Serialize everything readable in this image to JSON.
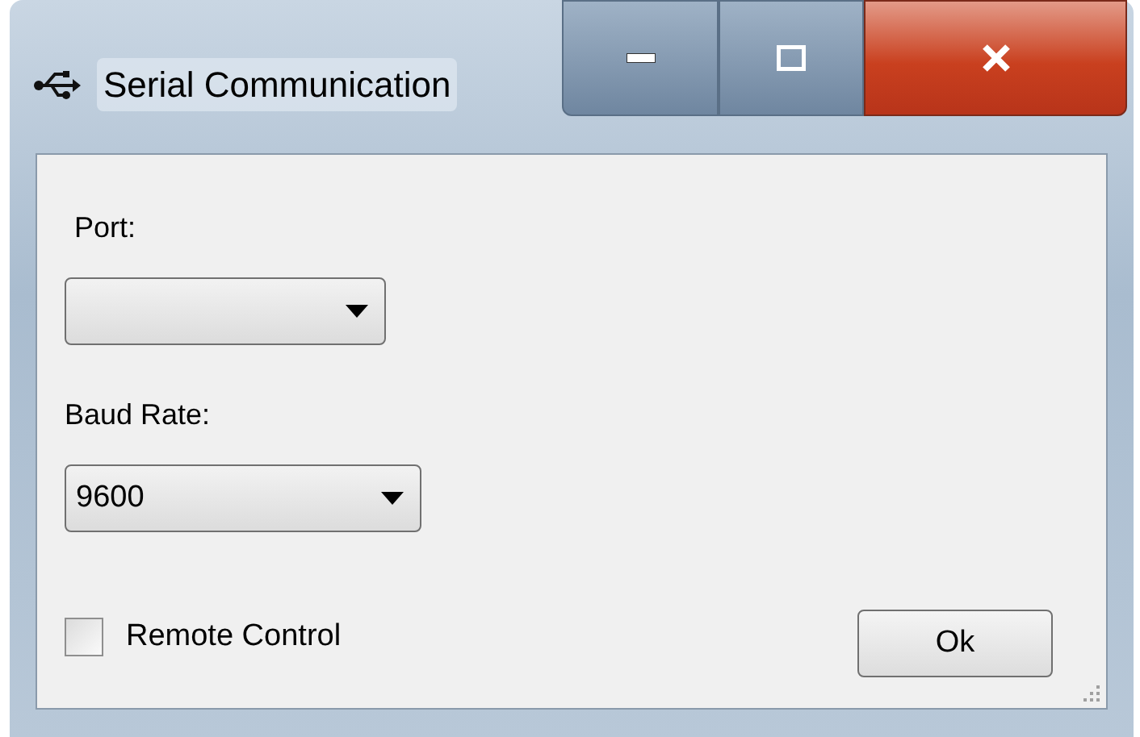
{
  "window": {
    "title": "Serial Communication"
  },
  "port": {
    "label": "Port:"
  },
  "baud_rate": {
    "label": "Baud Rate:",
    "value": "9600"
  },
  "remote_control": {
    "label": "Remote Control",
    "checked": false
  },
  "ok_button": {
    "label": "Ok"
  }
}
